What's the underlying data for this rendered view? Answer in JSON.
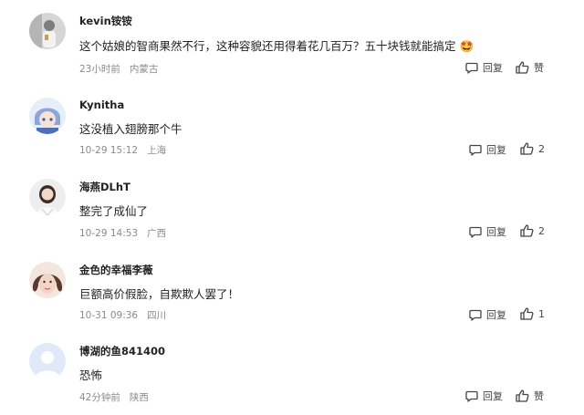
{
  "reply_label": "回复",
  "comments": [
    {
      "username": "kevin铵铵",
      "text": "这个姑娘的智商果然不行，这种容貌还用得着花几百万？五十块钱就能搞定 🤩",
      "time": "23小时前",
      "location": "内蒙古",
      "like_label": "赞",
      "avatar_color": "#9a9a9a"
    },
    {
      "username": "Kynitha",
      "text": "这没植入翅膀那个牛",
      "time": "10-29 15:12",
      "location": "上海",
      "like_label": "2",
      "avatar_color": "#6f8fd0"
    },
    {
      "username": "海燕DLhT",
      "text": "整完了成仙了",
      "time": "10-29 14:53",
      "location": "广西",
      "like_label": "2",
      "avatar_color": "#caa98a"
    },
    {
      "username": "金色的幸福李薇",
      "text": "巨额高价假脸，自欺欺人罢了！",
      "time": "10-31 09:36",
      "location": "四川",
      "like_label": "1",
      "avatar_color": "#d9a78f"
    },
    {
      "username": "博湖的鱼841400",
      "text": "恐怖",
      "time": "42分钟前",
      "location": "陕西",
      "like_label": "赞",
      "avatar_color": "#c9d9f2"
    }
  ]
}
